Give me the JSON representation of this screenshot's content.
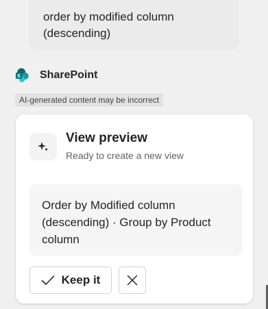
{
  "user_message": {
    "text": "order by modified column (descending)"
  },
  "assistant": {
    "name": "SharePoint",
    "ai_disclaimer": "AI-generated content may be incorrect"
  },
  "card": {
    "icon": "sparkle-icon",
    "title": "View preview",
    "subtitle": "Ready to create a new view",
    "summary": "Order by Modified column (descending) · Group by Product column",
    "keep_label": "Keep it",
    "keep_icon": "checkmark-icon",
    "dismiss_icon": "close-icon"
  },
  "colors": {
    "sharepoint_teal": "#038387",
    "sharepoint_dark": "#05595e",
    "card_bg": "#ffffff",
    "bubble_bg": "#ebebeb"
  }
}
